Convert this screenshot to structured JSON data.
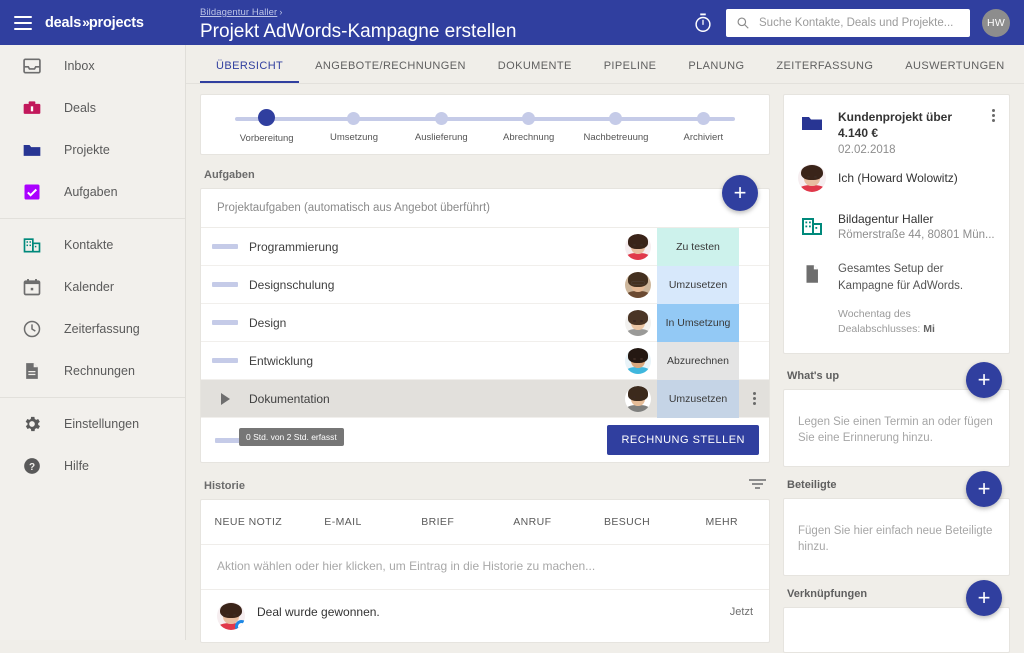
{
  "topbar": {
    "menu_icon": "hamburger-icon",
    "brand_left": "deals",
    "brand_chevron": "»",
    "brand_right": "projects",
    "breadcrumb": "Bildagentur Haller",
    "breadcrumb_separator": "›",
    "page_title": "Projekt AdWords-Kampagne erstellen",
    "timer_icon": "stopwatch-icon",
    "search_placeholder": "Suche Kontakte, Deals und Projekte...",
    "search_value": "",
    "search_icon": "search-icon",
    "user_initials": "HW",
    "bg_color": "#303f9f"
  },
  "sidebar": {
    "items": [
      {
        "label": "Inbox",
        "icon": "inbox-icon"
      },
      {
        "label": "Deals",
        "icon": "briefcase-icon"
      },
      {
        "label": "Projekte",
        "icon": "folder-icon"
      },
      {
        "label": "Aufgaben",
        "icon": "checkbox-icon"
      },
      {
        "label": "Kontakte",
        "icon": "building-icon"
      },
      {
        "label": "Kalender",
        "icon": "calendar-icon"
      },
      {
        "label": "Zeiterfassung",
        "icon": "clock-icon"
      },
      {
        "label": "Rechnungen",
        "icon": "document-icon"
      },
      {
        "label": "Einstellungen",
        "icon": "gear-icon"
      },
      {
        "label": "Hilfe",
        "icon": "help-circle-icon"
      }
    ]
  },
  "tabs": [
    {
      "label": "ÜBERSICHT",
      "active": true
    },
    {
      "label": "ANGEBOTE/RECHNUNGEN",
      "active": false
    },
    {
      "label": "DOKUMENTE",
      "active": false
    },
    {
      "label": "PIPELINE",
      "active": false
    },
    {
      "label": "PLANUNG",
      "active": false
    },
    {
      "label": "ZEITERFASSUNG",
      "active": false
    },
    {
      "label": "AUSWERTUNGEN",
      "active": false
    }
  ],
  "stages": {
    "active_index": 0,
    "items": [
      {
        "label": "Vorbereitung"
      },
      {
        "label": "Umsetzung"
      },
      {
        "label": "Auslieferung"
      },
      {
        "label": "Abrechnung"
      },
      {
        "label": "Nachbetreuung"
      },
      {
        "label": "Archiviert"
      }
    ],
    "active_color": "#303f9f",
    "inactive_color": "#c5cbe8"
  },
  "tasks": {
    "section_title": "Aufgaben",
    "add_label": "+",
    "subtitle": "Projektaufgaben (automatisch aus Angebot überführt)",
    "rows": [
      {
        "name": "Programmierung",
        "status": "Zu testen",
        "status_color": "#cdf2ec",
        "selected": false,
        "expandable": false
      },
      {
        "name": "Designschulung",
        "status": "Umzusetzen",
        "status_color": "#d7e8fb",
        "selected": false,
        "expandable": false
      },
      {
        "name": "Design",
        "status": "In Umsetzung",
        "status_color": "#93c9f5",
        "selected": false,
        "expandable": false
      },
      {
        "name": "Entwicklung",
        "status": "Abzurechnen",
        "status_color": "#e4e4e4",
        "selected": false,
        "expandable": false
      },
      {
        "name": "Dokumentation",
        "status": "Umzusetzen",
        "status_color": "#c5d4e6",
        "selected": true,
        "expandable": true
      }
    ],
    "tooltip": "0 Std. von 2 Std. erfasst",
    "invoice_button": "RECHNUNG STELLEN"
  },
  "history": {
    "section_title": "Historie",
    "filter_icon": "filter-icon",
    "action_tabs": [
      "NEUE NOTIZ",
      "E-MAIL",
      "BRIEF",
      "ANRUF",
      "BESUCH",
      "MEHR"
    ],
    "input_placeholder": "Aktion wählen oder hier klicken, um Eintrag in die Historie zu machen...",
    "entries": [
      {
        "text": "Deal wurde gewonnen.",
        "time": "Jetzt"
      }
    ]
  },
  "deal_card": {
    "folder_icon": "folder-icon",
    "title_line1": "Kundenprojekt über",
    "title_line2": "4.140 €",
    "date": "02.02.2018",
    "kebab_icon": "kebab-menu-icon",
    "owner": "Ich (Howard Wolowitz)",
    "company_icon": "building-icon",
    "company_name": "Bildagentur Haller",
    "company_address": "Römerstraße 44, 80801 Mün...",
    "note_icon": "document-icon",
    "note_text": "Gesamtes Setup der Kampagne für AdWords.",
    "meta_label": "Wochentag des Dealabschlusses:",
    "meta_value": "Mi"
  },
  "side_sections": [
    {
      "title": "What's up",
      "empty_text": "Legen Sie einen Termin an oder fügen Sie eine Erinnerung hinzu.",
      "add_label": "+"
    },
    {
      "title": "Beteiligte",
      "empty_text": "Fügen Sie hier einfach neue Beteiligte hinzu.",
      "add_label": "+"
    },
    {
      "title": "Verknüpfungen",
      "empty_text": "",
      "add_label": "+"
    }
  ]
}
